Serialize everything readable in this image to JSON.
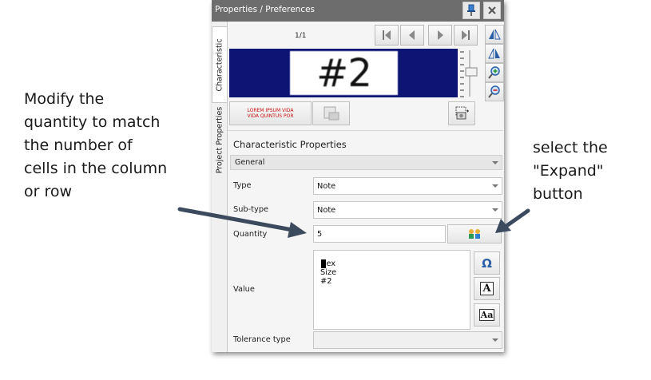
{
  "annotations": {
    "left_note": "Modify the\nquantity to match\nthe number of\ncells in the column\nor row",
    "right_note": "select the\n\"Expand\"\nbutton"
  },
  "window": {
    "title": "Properties / Preferences",
    "pin_icon": "pin-icon",
    "close_icon": "close-icon"
  },
  "side_tabs": [
    {
      "label": "Characteristic",
      "active": true
    },
    {
      "label": "Project Properties",
      "active": false
    }
  ],
  "navigator": {
    "page_indicator": "1/1",
    "buttons": [
      "first-page-icon",
      "previous-page-icon",
      "next-page-icon",
      "last-page-icon"
    ]
  },
  "preview": {
    "label_text": "#2",
    "background_color": "#0d1473"
  },
  "format_buttons": {
    "text_style_sample_line1": "LOREM IPSUM VIDA",
    "text_style_sample_line2": "VIDA QUINTUS POR"
  },
  "properties": {
    "section_title": "Characteristic Properties",
    "group_label": "General",
    "type": {
      "label": "Type",
      "value": "Note"
    },
    "sub_type": {
      "label": "Sub-type",
      "value": "Note"
    },
    "quantity": {
      "label": "Quantity",
      "value": "5"
    },
    "value": {
      "label": "Value",
      "text": "Hex Size #2"
    },
    "tolerance_type": {
      "label": "Tolerance type",
      "value": ""
    }
  },
  "text_buttons": {
    "omega": "Ω",
    "font": "A",
    "case": "Aa"
  },
  "colors": {
    "titlebar": "#6d6d6d",
    "arrow": "#3c4a5e",
    "preview_bg": "#0d1473"
  }
}
